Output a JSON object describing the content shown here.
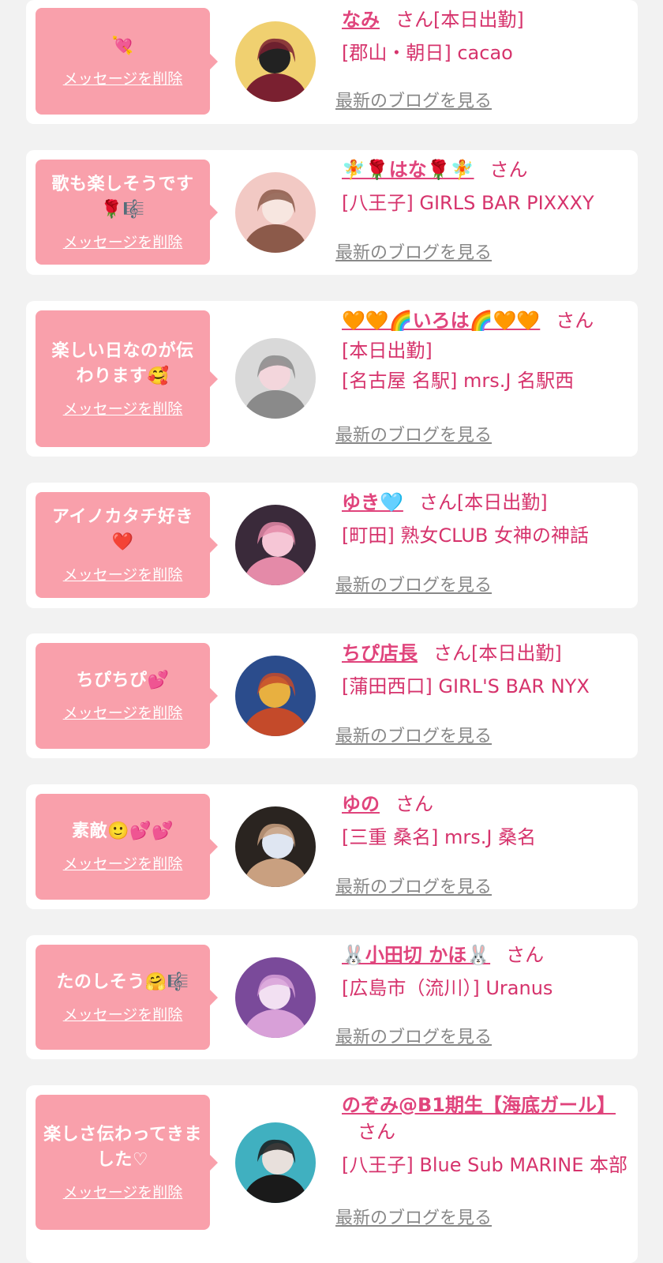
{
  "colors": {
    "background": "#f2f2f2",
    "card": "#ffffff",
    "bubble": "#f9a0ab",
    "accent_pink": "#e0447c",
    "link_gray": "#888888"
  },
  "delete_label": "メッセージを削除",
  "blog_label": "最新のブログを見る",
  "cards": [
    {
      "message": "💘",
      "name": "なみ",
      "suffix": "さん[本日出勤]",
      "shop": "[郡山・朝日] cacao",
      "avatar_colors": [
        "#f0d070",
        "#7a2030",
        "#222222"
      ]
    },
    {
      "message": "歌も楽しそうです🌹🎼",
      "name": "🧚🌹はな🌹🧚",
      "suffix": "さん",
      "shop": "[八王子] GIRLS BAR PIXXXY",
      "avatar_colors": [
        "#f2c9c4",
        "#8c5a4a",
        "#f7e6e0"
      ]
    },
    {
      "message": "楽しい日なのが伝わります🥰",
      "name": "🧡🧡🌈いろは🌈🧡🧡",
      "suffix": "さん",
      "status": "[本日出勤]",
      "shop": "[名古屋 名駅] mrs.J 名駅西",
      "avatar_colors": [
        "#d9d9d9",
        "#8a8a8a",
        "#f3d6dc"
      ]
    },
    {
      "message": "アイノカタチ好き❤️",
      "name": "ゆき🩵",
      "suffix": "さん[本日出勤]",
      "shop": "[町田] 熟女CLUB 女神の神話",
      "avatar_colors": [
        "#3a2a3a",
        "#e48aa8",
        "#f6c6d6"
      ]
    },
    {
      "message": "ちぴちぴ💕",
      "name": "ちぴ店長",
      "suffix": "さん[本日出勤]",
      "shop": "[蒲田西口] GIRL'S BAR NYX",
      "avatar_colors": [
        "#2b4c8c",
        "#c44a2a",
        "#e8b040"
      ]
    },
    {
      "message": "素敵🙂💕💕",
      "name": "ゆの",
      "suffix": "さん",
      "shop": "[三重 桑名] mrs.J 桑名",
      "avatar_colors": [
        "#2a2420",
        "#c9a080",
        "#dfe6f2"
      ]
    },
    {
      "message": "たのしそう🤗🎼",
      "name": "🐰小田切 かほ🐰",
      "suffix": "さん",
      "shop": "[広島市（流川）] Uranus",
      "avatar_colors": [
        "#7a4a9a",
        "#d8a0d8",
        "#f2e0f2"
      ]
    },
    {
      "message": "楽しさ伝わってきました♡",
      "name": "のぞみ@B1期生【海底ガール】",
      "suffix": "さん",
      "shop": "[八王子] Blue Sub MARINE 本部",
      "avatar_colors": [
        "#40b0c0",
        "#1a1a1a",
        "#e8e0dc"
      ]
    }
  ]
}
